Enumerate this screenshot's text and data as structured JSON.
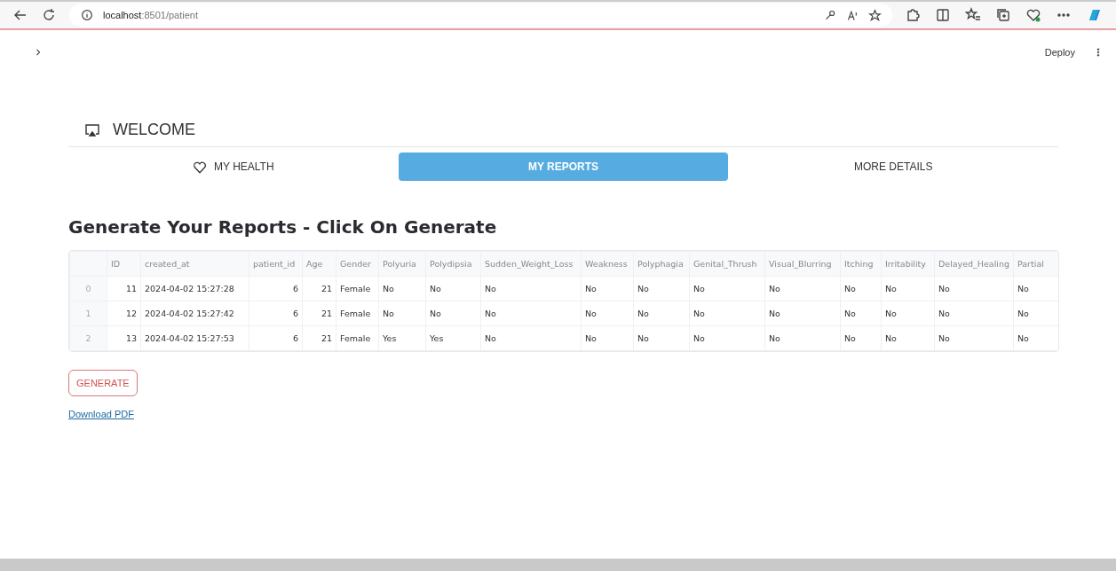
{
  "browser": {
    "url_host": "localhost",
    "url_path": ":8501/patient"
  },
  "app": {
    "deploy": "Deploy",
    "title": "WELCOME",
    "tabs": [
      {
        "label": "MY HEALTH",
        "selected": false
      },
      {
        "label": "MY REPORTS",
        "selected": true
      },
      {
        "label": "MORE DETAILS",
        "selected": false
      }
    ],
    "heading": "Generate Your Reports - Click On Generate",
    "table": {
      "columns": [
        {
          "label": "ID",
          "kind": "number"
        },
        {
          "label": "created_at",
          "kind": "text"
        },
        {
          "label": "patient_id",
          "kind": "number"
        },
        {
          "label": "Age",
          "kind": "number"
        },
        {
          "label": "Gender",
          "kind": "text"
        },
        {
          "label": "Polyuria",
          "kind": "text"
        },
        {
          "label": "Polydipsia",
          "kind": "text"
        },
        {
          "label": "Sudden_Weight_Loss",
          "kind": "text"
        },
        {
          "label": "Weakness",
          "kind": "text"
        },
        {
          "label": "Polyphagia",
          "kind": "text"
        },
        {
          "label": "Genital_Thrush",
          "kind": "text"
        },
        {
          "label": "Visual_Blurring",
          "kind": "text"
        },
        {
          "label": "Itching",
          "kind": "text"
        },
        {
          "label": "Irritability",
          "kind": "text"
        },
        {
          "label": "Delayed_Healing",
          "kind": "text"
        },
        {
          "label": "Partial",
          "kind": "text"
        }
      ],
      "rows": [
        {
          "index": "0",
          "cells": [
            "11",
            "2024-04-02 15:27:28",
            "6",
            "21",
            "Female",
            "No",
            "No",
            "No",
            "No",
            "No",
            "No",
            "No",
            "No",
            "No",
            "No",
            "No"
          ]
        },
        {
          "index": "1",
          "cells": [
            "12",
            "2024-04-02 15:27:42",
            "6",
            "21",
            "Female",
            "No",
            "No",
            "No",
            "No",
            "No",
            "No",
            "No",
            "No",
            "No",
            "No",
            "No"
          ]
        },
        {
          "index": "2",
          "cells": [
            "13",
            "2024-04-02 15:27:53",
            "6",
            "21",
            "Female",
            "Yes",
            "Yes",
            "No",
            "No",
            "No",
            "No",
            "No",
            "No",
            "No",
            "No",
            "No"
          ]
        }
      ]
    },
    "generate_button": "GENERATE",
    "download_link": "Download PDF"
  }
}
